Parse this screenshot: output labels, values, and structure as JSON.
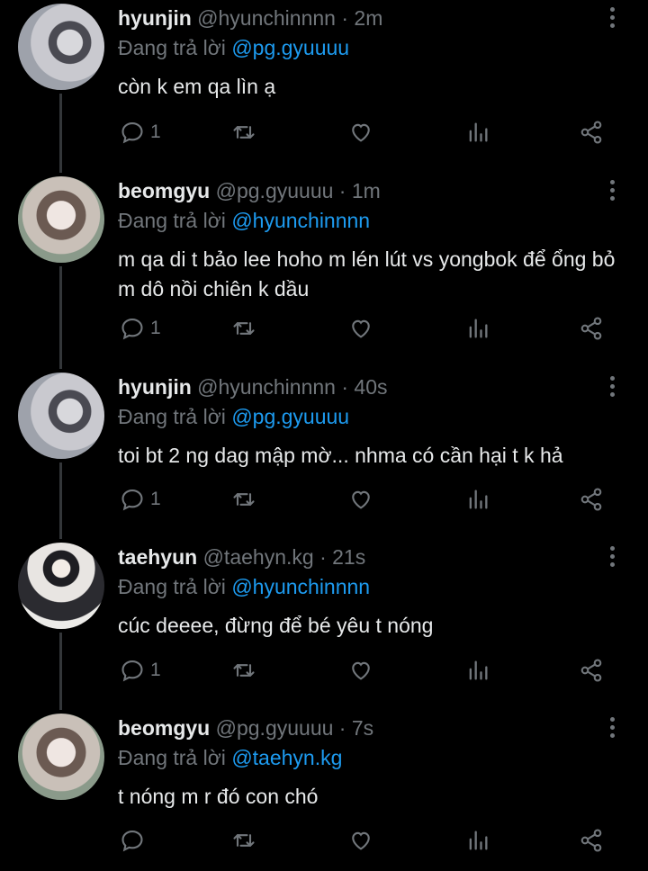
{
  "reply_prefix": "Đang trả lời",
  "tweets": [
    {
      "name": "hyunjin",
      "handle": "@hyunchinnnn",
      "dot": "·",
      "time": "2m",
      "reply_to": "@pg.gyuuuu",
      "text": "còn k em qa lìn ạ",
      "reply_count": "1"
    },
    {
      "name": "beomgyu",
      "handle": "@pg.gyuuuu",
      "dot": "·",
      "time": "1m",
      "reply_to": "@hyunchinnnn",
      "text": "m qa di t bảo lee hoho m lén lút vs yongbok để ổng bỏ m dô nồi chiên k dầu",
      "reply_count": "1"
    },
    {
      "name": "hyunjin",
      "handle": "@hyunchinnnn",
      "dot": "·",
      "time": "40s",
      "reply_to": "@pg.gyuuuu",
      "text": "toi bt 2 ng dag mập mờ... nhma có cần hại t k hả",
      "reply_count": "1"
    },
    {
      "name": "taehyun",
      "handle": "@taehyn.kg",
      "dot": "·",
      "time": "21s",
      "reply_to": "@hyunchinnnn",
      "text": "cúc deeee, đừng để bé yêu t nóng",
      "reply_count": "1"
    },
    {
      "name": "beomgyu",
      "handle": "@pg.gyuuuu",
      "dot": "·",
      "time": "7s",
      "reply_to": "@taehyn.kg",
      "text": "t nóng m r đó con chó",
      "reply_count": ""
    }
  ],
  "icons": {
    "reply": "reply-icon",
    "retweet": "retweet-icon",
    "like": "heart-icon",
    "stats": "analytics-icon",
    "share": "share-icon",
    "more": "more-vertical-icon"
  },
  "colors": {
    "background": "#000000",
    "text": "#e7e9ea",
    "muted": "#71767b",
    "link": "#1d9bf0",
    "thread_line": "#333639"
  }
}
